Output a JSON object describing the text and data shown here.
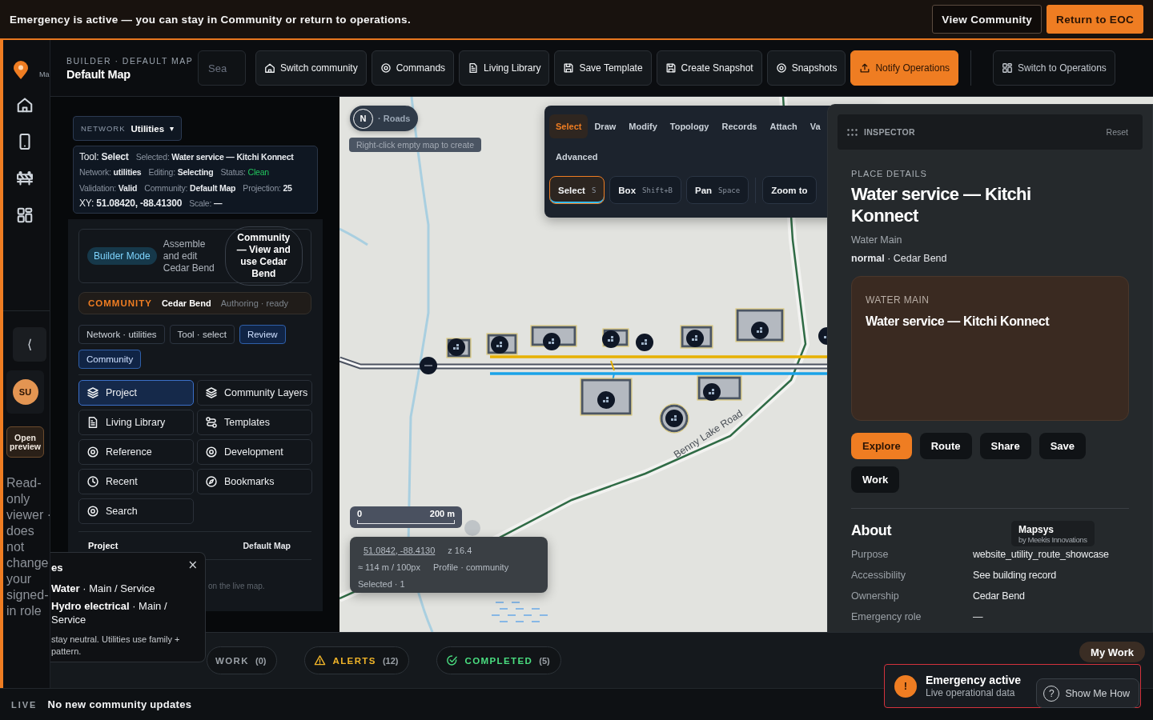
{
  "banner": {
    "message": "Emergency is active — you can stay in Community or return to operations.",
    "actions": [
      {
        "label": "View Community",
        "kind": "secondary"
      },
      {
        "label": "Return to EOC",
        "kind": "primary"
      }
    ]
  },
  "rail": {
    "cut_label": "Ma",
    "collapse": "⟨",
    "avatar": "SU",
    "preview_button": "Open preview",
    "note": "Read-only viewer · does not change your signed-in role"
  },
  "header": {
    "eyebrow": "BUILDER · DEFAULT MAP",
    "title": "Default Map",
    "search": {
      "placeholder": "Sea"
    },
    "actions": [
      {
        "label": "Switch community",
        "kind": "default"
      },
      {
        "label": "Commands",
        "kind": "default"
      },
      {
        "label": "Living Library",
        "kind": "default"
      },
      {
        "label": "Save Template",
        "kind": "default"
      },
      {
        "label": "Create Snapshot",
        "kind": "default"
      },
      {
        "label": "Snapshots",
        "kind": "default"
      },
      {
        "label": "Notify Operations",
        "kind": "primary"
      },
      {
        "label": "Switch to Operations",
        "kind": "separate"
      }
    ]
  },
  "left_panel": {
    "network": {
      "label": "NETWORK",
      "value": "Utilities",
      "caret": "▾"
    },
    "status": [
      [
        {
          "text": "Tool: **Select**",
          "kind": "lead"
        },
        {
          "text": "Selected: **Water service — Kitchi Konnect**",
          "kind": "field"
        }
      ],
      [
        {
          "text": "Network: **utilities**",
          "kind": "field"
        },
        {
          "text": "Editing: **Selecting**",
          "kind": "field"
        },
        {
          "text": "Status: Clean",
          "kind": "status"
        }
      ],
      [
        {
          "text": "Validation: **Valid**",
          "kind": "field"
        },
        {
          "text": "Community: **Default Map**",
          "kind": "field"
        },
        {
          "text": "Projection: **25**",
          "kind": "field"
        }
      ],
      [
        {
          "text": "XY: **51.08420, -88.41300**",
          "kind": "lead"
        },
        {
          "text": "Scale: **—**",
          "kind": "field"
        }
      ]
    ],
    "mode": {
      "badge": "Builder Mode",
      "description": "Assemble and edit Cedar Bend",
      "switch": "Community — View and use Cedar Bend"
    },
    "community": {
      "label": "COMMUNITY",
      "name": "Cedar Bend",
      "status": "Authoring · ready"
    },
    "chips": [
      {
        "label": "Network · utilities",
        "selected": false
      },
      {
        "label": "Tool · select",
        "selected": false
      },
      {
        "label": "Review",
        "selected": true
      },
      {
        "label": "Community",
        "selected": true
      }
    ],
    "nav": [
      {
        "label": "Project",
        "selected": true
      },
      {
        "label": "Community Layers",
        "selected": false
      },
      {
        "label": "Living Library",
        "selected": false
      },
      {
        "label": "Templates",
        "selected": false
      },
      {
        "label": "Reference",
        "selected": false
      },
      {
        "label": "Development",
        "selected": false
      },
      {
        "label": "Recent",
        "selected": false
      },
      {
        "label": "Bookmarks",
        "selected": false
      },
      {
        "label": "Search",
        "selected": false
      }
    ],
    "footer": {
      "label": "Project",
      "value": "Default Map"
    },
    "hint_fragment": "on the live map."
  },
  "map": {
    "compass": {
      "letter": "N",
      "layer": "· Roads"
    },
    "hint": "Right-click empty map to create",
    "toolbar": {
      "tabs": [
        {
          "label": "Select",
          "selected": true
        },
        {
          "label": "Draw",
          "selected": false
        },
        {
          "label": "Modify",
          "selected": false
        },
        {
          "label": "Topology",
          "selected": false
        },
        {
          "label": "Records",
          "selected": false
        },
        {
          "label": "Attach",
          "selected": false
        },
        {
          "label": "Va",
          "selected": false
        },
        {
          "label": "Advanced",
          "selected": false
        }
      ],
      "tools": [
        {
          "label": "Select",
          "shortcut": "S",
          "selected": true
        },
        {
          "label": "Box",
          "shortcut": "Shift+B",
          "selected": false
        },
        {
          "label": "Pan",
          "shortcut": "Space",
          "selected": false
        },
        {
          "label": "Zoom to",
          "selected": false
        }
      ]
    },
    "road_label": "Benny Lake Road",
    "scale": {
      "start": "0",
      "end": "200 m"
    },
    "readout": {
      "coordinates": "51.0842, -88.4130",
      "zoom": "z 16.4",
      "resolution": "≈ 114 m / 100px",
      "profile": "Profile · community",
      "selection": "Selected · 1"
    }
  },
  "inspector": {
    "title": "INSPECTOR",
    "reset": "Reset",
    "eyebrow": "PLACE DETAILS",
    "name": "Water service — Kitchi Konnect",
    "type": "Water Main",
    "meta": "**normal** · Cedar Bend",
    "card": {
      "eyebrow": "WATER MAIN",
      "title": "Water service — Kitchi Konnect"
    },
    "actions": [
      {
        "label": "Explore",
        "kind": "primary"
      },
      {
        "label": "Route",
        "kind": "default"
      },
      {
        "label": "Share",
        "kind": "default"
      },
      {
        "label": "Save",
        "kind": "default"
      },
      {
        "label": "Work",
        "kind": "default"
      }
    ],
    "about": {
      "heading": "About",
      "rows": [
        {
          "key": "Purpose",
          "value": "website_utility_route_showcase"
        },
        {
          "key": "Accessibility",
          "value": "See building record"
        },
        {
          "key": "Ownership",
          "value": "Cedar Bend"
        },
        {
          "key": "Emergency role",
          "value": "—"
        }
      ]
    },
    "attribution": {
      "name": "Mapsys",
      "by": "by Meekis Innovations"
    }
  },
  "popup": {
    "title": "es",
    "close": "×",
    "items": [
      "**Water** · Main / Service",
      "**Hydro electrical** · Main / Service"
    ],
    "note": "stay neutral. Utilities use family + pattern."
  },
  "bottom_bar": {
    "tabs": [
      {
        "label": "WORK",
        "count": "(0)",
        "kind": "muted"
      },
      {
        "label": "ALERTS",
        "count": "(12)",
        "kind": "warning"
      },
      {
        "label": "COMPLETED",
        "count": "(5)",
        "kind": "success"
      }
    ],
    "my_work": "My Work"
  },
  "toast": {
    "icon": "!",
    "title": "Emergency active",
    "subtitle": "Live operational data",
    "help": {
      "icon": "?",
      "label": "Show Me How"
    }
  },
  "status_bar": {
    "tag": "LIVE",
    "message": "No new community updates"
  }
}
